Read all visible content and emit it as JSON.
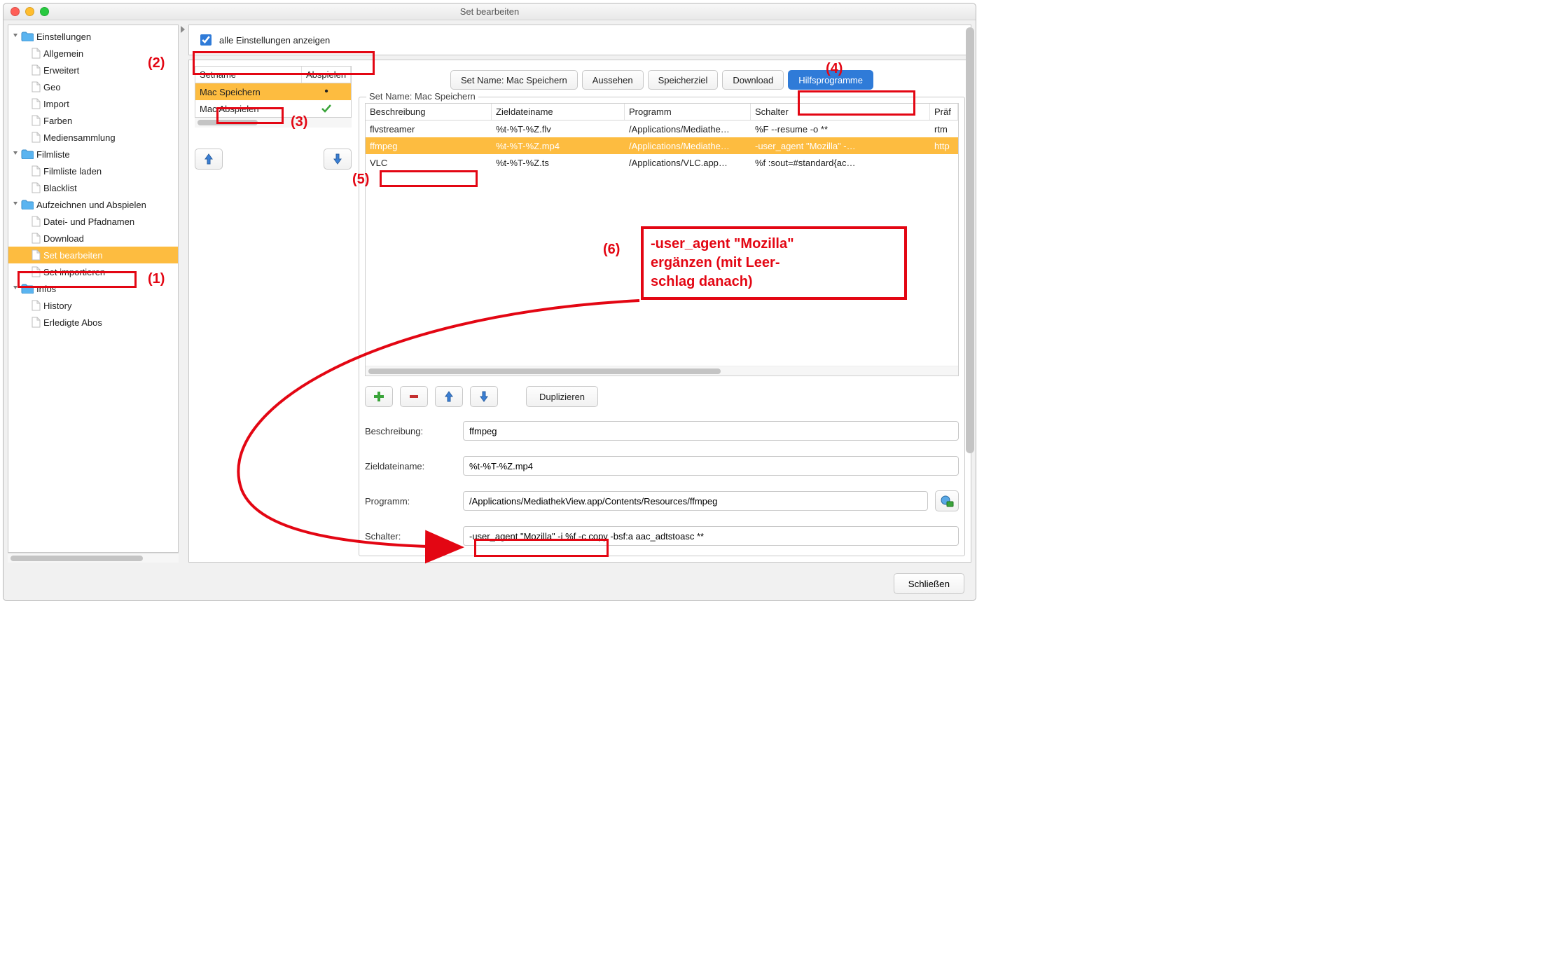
{
  "window_title": "Set bearbeiten",
  "show_all_label": "alle Einstellungen anzeigen",
  "sidebar": {
    "groups": [
      {
        "label": "Einstellungen",
        "children": [
          {
            "label": "Allgemein"
          },
          {
            "label": "Erweitert"
          },
          {
            "label": "Geo"
          },
          {
            "label": "Import"
          },
          {
            "label": "Farben"
          },
          {
            "label": "Mediensammlung"
          }
        ]
      },
      {
        "label": "Filmliste",
        "children": [
          {
            "label": "Filmliste laden"
          },
          {
            "label": "Blacklist"
          }
        ]
      },
      {
        "label": "Aufzeichnen und Abspielen",
        "children": [
          {
            "label": "Datei- und Pfadnamen"
          },
          {
            "label": "Download"
          },
          {
            "label": "Set bearbeiten",
            "selected": true
          },
          {
            "label": "Set importieren"
          }
        ]
      },
      {
        "label": "Infos",
        "children": [
          {
            "label": "History"
          },
          {
            "label": "Erledigte Abos"
          }
        ]
      }
    ]
  },
  "setlist": {
    "columns": [
      "Setname",
      "Abspielen"
    ],
    "rows": [
      {
        "name": "Mac Speichern",
        "play": "•",
        "selected": true
      },
      {
        "name": "Mac Abspielen",
        "play": "✓"
      }
    ]
  },
  "tabs": [
    "Set Name: Mac Speichern",
    "Aussehen",
    "Speicherziel",
    "Download",
    "Hilfsprogramme"
  ],
  "tabs_active_index": 4,
  "group_title": "Set Name: Mac Speichern",
  "program_table": {
    "columns": [
      "Beschreibung",
      "Zieldateiname",
      "Programm",
      "Schalter",
      "Präf"
    ],
    "rows": [
      {
        "b": "flvstreamer",
        "z": "%t-%T-%Z.flv",
        "p": "/Applications/Mediathe…",
        "s": "%F --resume -o **",
        "r": "rtm"
      },
      {
        "b": "ffmpeg",
        "z": "%t-%T-%Z.mp4",
        "p": "/Applications/Mediathe…",
        "s": "-user_agent \"Mozilla\" -…",
        "r": "http",
        "selected": true
      },
      {
        "b": "VLC",
        "z": "%t-%T-%Z.ts",
        "p": "/Applications/VLC.app…",
        "s": "%f :sout=#standard{ac…",
        "r": ""
      }
    ]
  },
  "duplicate_label": "Duplizieren",
  "form": {
    "description_label": "Beschreibung:",
    "description_value": "ffmpeg",
    "target_label": "Zieldateiname:",
    "target_value": "%t-%T-%Z.mp4",
    "program_label": "Programm:",
    "program_value": "/Applications/MediathekView.app/Contents/Resources/ffmpeg",
    "switch_label": "Schalter:",
    "switch_value": "-user_agent \"Mozilla\" -i %f -c copy -bsf:a aac_adtstoasc **"
  },
  "close_label": "Schließen",
  "annotations": {
    "n1": "(1)",
    "n2": "(2)",
    "n3": "(3)",
    "n4": "(4)",
    "n5": "(5)",
    "n6": "(6)",
    "callout_l1": "-user_agent \"Mozilla\"",
    "callout_l2": "ergänzen (mit Leer-",
    "callout_l3": "schlag danach)"
  }
}
